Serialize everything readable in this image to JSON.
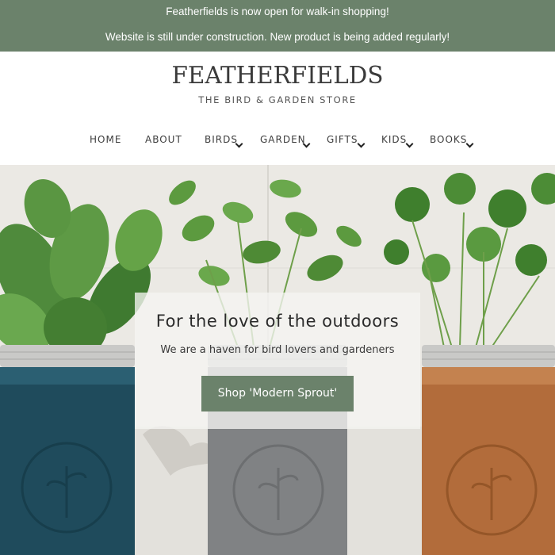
{
  "announcement": {
    "line1": "Featherfields is now open for walk-in shopping!",
    "line2": "Website is still under construction. New product is being added regularly!"
  },
  "brand": {
    "logo_text": "FEATHERFIELDS",
    "tagline": "THE BIRD & GARDEN STORE"
  },
  "nav": {
    "items": [
      {
        "label": "HOME",
        "has_dropdown": false
      },
      {
        "label": "ABOUT",
        "has_dropdown": false
      },
      {
        "label": "BIRDS",
        "has_dropdown": true
      },
      {
        "label": "GARDEN",
        "has_dropdown": true
      },
      {
        "label": "GIFTS",
        "has_dropdown": true
      },
      {
        "label": "KIDS",
        "has_dropdown": true
      },
      {
        "label": "BOOKS",
        "has_dropdown": true
      }
    ]
  },
  "hero": {
    "title": "For the love of the outdoors",
    "subtitle": "We are a haven for bird lovers and gardeners",
    "button_label": "Shop 'Modern Sprout'"
  },
  "colors": {
    "accent": "#6b826b",
    "jar_left": "#1d4a5a",
    "jar_middle": "#808284",
    "jar_right": "#b06b3a"
  }
}
